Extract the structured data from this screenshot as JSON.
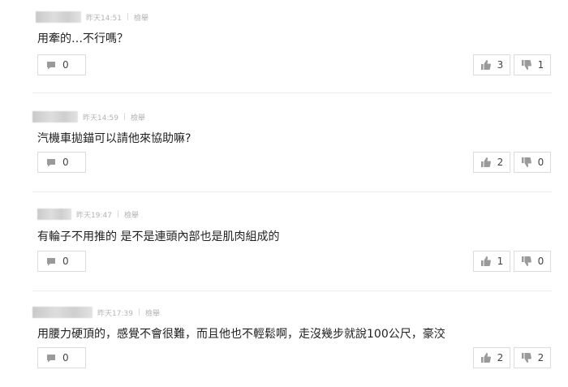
{
  "comments": [
    {
      "time": "昨天14:51",
      "action": "檢舉",
      "text": "用牽的…不行嗎？",
      "replies": "0",
      "likes": "3",
      "dislikes": "1"
    },
    {
      "time": "昨天14:59",
      "action": "檢舉",
      "text": "汽機車拋錨可以請他來協助嘛?",
      "replies": "0",
      "likes": "2",
      "dislikes": "0"
    },
    {
      "time": "昨天19:47",
      "action": "檢舉",
      "text": "有輪子不用推的 是不是連頭內部也是肌肉組成的",
      "replies": "0",
      "likes": "1",
      "dislikes": "0"
    },
    {
      "time": "昨天17:39",
      "action": "檢舉",
      "text": "用腰力硬頂的，感覺不會很難，而且他也不輕鬆啊，走沒幾步就說100公尺，豪洨",
      "replies": "0",
      "likes": "2",
      "dislikes": "2"
    }
  ],
  "icons": {
    "reply": "comment-icon",
    "like": "thumbs-up-icon",
    "dislike": "thumbs-down-icon"
  }
}
